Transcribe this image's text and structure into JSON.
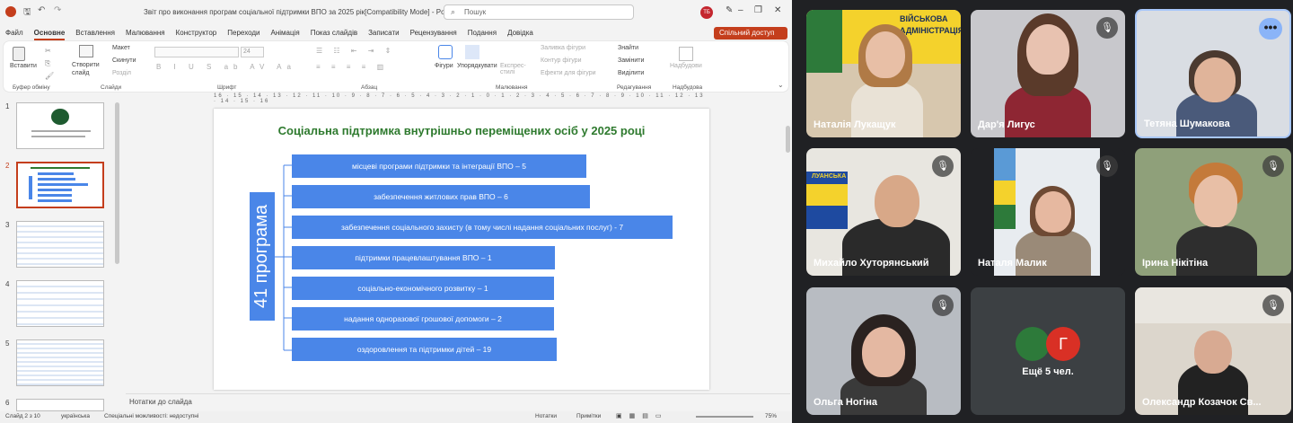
{
  "pp": {
    "title": "Звіт про виконання програм соціальної підтримки ВПО за 2025 рік[Compatibility Mode] - PowerP...",
    "search": "Пошук",
    "user_initials": "ТБ",
    "tabs": [
      "Файл",
      "Основне",
      "Вставлення",
      "Малювання",
      "Конструктор",
      "Переходи",
      "Анімація",
      "Показ слайдів",
      "Записати",
      "Рецензування",
      "Подання",
      "Довідка"
    ],
    "share": "Спільний доступ",
    "ribbon": {
      "paste": "Вставити",
      "clipboard": "Буфер обміну",
      "new_slide": "Створити слайд",
      "layout": "Макет",
      "reset": "Скинути",
      "section": "Розділ",
      "slides": "Слайди",
      "font": "Шрифт",
      "font_size": "24",
      "paragraph": "Абзац",
      "shapes": "Фігури",
      "arrange": "Упорядкувати",
      "quick_styles": "Експрес-стилі",
      "fill": "Заливка фігури",
      "outline": "Контур фігури",
      "effects": "Ефекти для фігури",
      "drawing": "Малювання",
      "find": "Знайти",
      "replace": "Замінити",
      "select": "Виділити",
      "editing": "Редагування",
      "addins": "Надбудови",
      "addins_group": "Надбудова"
    },
    "ruler": "16 · 15 · 14 · 13 · 12 · 11 · 10 · 9 · 8 · 7 · 6 · 5 · 4 · 3 · 2 · 1 · 0 · 1 · 2 · 3 · 4 · 5 · 6 · 7 · 8 · 9 · 10 · 11 · 12 · 13 · 14 · 15 · 16",
    "slide_numbers": [
      "1",
      "2",
      "3",
      "4",
      "5",
      "6"
    ],
    "slide": {
      "title": "Соціальна підтримка внутрішньо переміщених осіб у 2025 році",
      "vertical": "41 програма",
      "items": [
        "місцеві програми підтримки та інтеграції ВПО – 5",
        "забезпечення житлових прав ВПО – 6",
        "забезпечення соціального захисту (в тому числі надання соціальних послуг) - 7",
        "підтримки працевлаштування ВПО – 1",
        "соціально-економічного розвитку – 1",
        "надання одноразової грошової допомоги – 2",
        "оздоровлення та підтримки дітей – 19"
      ]
    },
    "notes": "Нотатки до слайда",
    "status": {
      "slide": "Слайд 2 з 10",
      "lang": "українська",
      "access": "Спеціальні можливості: недоступні",
      "notes": "Нотатки",
      "comments": "Примітки",
      "zoom": "75%"
    }
  },
  "meet": {
    "participants": [
      {
        "name": "Наталія Лукащук"
      },
      {
        "name": "Дар'я Лигус"
      },
      {
        "name": "Тетяна Шумакова"
      },
      {
        "name": "Михайло Хуторянський"
      },
      {
        "name": "Наталя Малик"
      },
      {
        "name": "Ірина Нікітіна"
      },
      {
        "name": "Ольга Ногіна"
      },
      {
        "name": "Олександр Козачок Св..."
      }
    ],
    "overflow": {
      "label": "Ещё 5 чел.",
      "initial": "Г"
    },
    "flag_text": "ВІЙСЬКОВА АДМІНІСТРАЦІЯ",
    "flag2_text": "ЛУАНСЬКА"
  }
}
